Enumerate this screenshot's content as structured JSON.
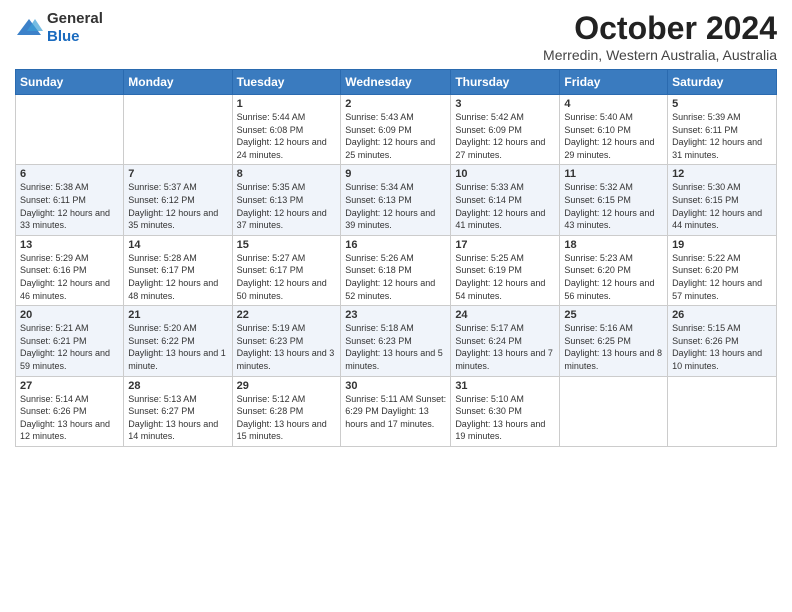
{
  "header": {
    "logo_line1": "General",
    "logo_line2": "Blue",
    "month": "October 2024",
    "location": "Merredin, Western Australia, Australia"
  },
  "days_of_week": [
    "Sunday",
    "Monday",
    "Tuesday",
    "Wednesday",
    "Thursday",
    "Friday",
    "Saturday"
  ],
  "weeks": [
    [
      {
        "day": "",
        "info": ""
      },
      {
        "day": "",
        "info": ""
      },
      {
        "day": "1",
        "info": "Sunrise: 5:44 AM\nSunset: 6:08 PM\nDaylight: 12 hours and 24 minutes."
      },
      {
        "day": "2",
        "info": "Sunrise: 5:43 AM\nSunset: 6:09 PM\nDaylight: 12 hours and 25 minutes."
      },
      {
        "day": "3",
        "info": "Sunrise: 5:42 AM\nSunset: 6:09 PM\nDaylight: 12 hours and 27 minutes."
      },
      {
        "day": "4",
        "info": "Sunrise: 5:40 AM\nSunset: 6:10 PM\nDaylight: 12 hours and 29 minutes."
      },
      {
        "day": "5",
        "info": "Sunrise: 5:39 AM\nSunset: 6:11 PM\nDaylight: 12 hours and 31 minutes."
      }
    ],
    [
      {
        "day": "6",
        "info": "Sunrise: 5:38 AM\nSunset: 6:11 PM\nDaylight: 12 hours and 33 minutes."
      },
      {
        "day": "7",
        "info": "Sunrise: 5:37 AM\nSunset: 6:12 PM\nDaylight: 12 hours and 35 minutes."
      },
      {
        "day": "8",
        "info": "Sunrise: 5:35 AM\nSunset: 6:13 PM\nDaylight: 12 hours and 37 minutes."
      },
      {
        "day": "9",
        "info": "Sunrise: 5:34 AM\nSunset: 6:13 PM\nDaylight: 12 hours and 39 minutes."
      },
      {
        "day": "10",
        "info": "Sunrise: 5:33 AM\nSunset: 6:14 PM\nDaylight: 12 hours and 41 minutes."
      },
      {
        "day": "11",
        "info": "Sunrise: 5:32 AM\nSunset: 6:15 PM\nDaylight: 12 hours and 43 minutes."
      },
      {
        "day": "12",
        "info": "Sunrise: 5:30 AM\nSunset: 6:15 PM\nDaylight: 12 hours and 44 minutes."
      }
    ],
    [
      {
        "day": "13",
        "info": "Sunrise: 5:29 AM\nSunset: 6:16 PM\nDaylight: 12 hours and 46 minutes."
      },
      {
        "day": "14",
        "info": "Sunrise: 5:28 AM\nSunset: 6:17 PM\nDaylight: 12 hours and 48 minutes."
      },
      {
        "day": "15",
        "info": "Sunrise: 5:27 AM\nSunset: 6:17 PM\nDaylight: 12 hours and 50 minutes."
      },
      {
        "day": "16",
        "info": "Sunrise: 5:26 AM\nSunset: 6:18 PM\nDaylight: 12 hours and 52 minutes."
      },
      {
        "day": "17",
        "info": "Sunrise: 5:25 AM\nSunset: 6:19 PM\nDaylight: 12 hours and 54 minutes."
      },
      {
        "day": "18",
        "info": "Sunrise: 5:23 AM\nSunset: 6:20 PM\nDaylight: 12 hours and 56 minutes."
      },
      {
        "day": "19",
        "info": "Sunrise: 5:22 AM\nSunset: 6:20 PM\nDaylight: 12 hours and 57 minutes."
      }
    ],
    [
      {
        "day": "20",
        "info": "Sunrise: 5:21 AM\nSunset: 6:21 PM\nDaylight: 12 hours and 59 minutes."
      },
      {
        "day": "21",
        "info": "Sunrise: 5:20 AM\nSunset: 6:22 PM\nDaylight: 13 hours and 1 minute."
      },
      {
        "day": "22",
        "info": "Sunrise: 5:19 AM\nSunset: 6:23 PM\nDaylight: 13 hours and 3 minutes."
      },
      {
        "day": "23",
        "info": "Sunrise: 5:18 AM\nSunset: 6:23 PM\nDaylight: 13 hours and 5 minutes."
      },
      {
        "day": "24",
        "info": "Sunrise: 5:17 AM\nSunset: 6:24 PM\nDaylight: 13 hours and 7 minutes."
      },
      {
        "day": "25",
        "info": "Sunrise: 5:16 AM\nSunset: 6:25 PM\nDaylight: 13 hours and 8 minutes."
      },
      {
        "day": "26",
        "info": "Sunrise: 5:15 AM\nSunset: 6:26 PM\nDaylight: 13 hours and 10 minutes."
      }
    ],
    [
      {
        "day": "27",
        "info": "Sunrise: 5:14 AM\nSunset: 6:26 PM\nDaylight: 13 hours and 12 minutes."
      },
      {
        "day": "28",
        "info": "Sunrise: 5:13 AM\nSunset: 6:27 PM\nDaylight: 13 hours and 14 minutes."
      },
      {
        "day": "29",
        "info": "Sunrise: 5:12 AM\nSunset: 6:28 PM\nDaylight: 13 hours and 15 minutes."
      },
      {
        "day": "30",
        "info": "Sunrise: 5:11 AM\nSunset: 6:29 PM\nDaylight: 13 hours and 17 minutes."
      },
      {
        "day": "31",
        "info": "Sunrise: 5:10 AM\nSunset: 6:30 PM\nDaylight: 13 hours and 19 minutes."
      },
      {
        "day": "",
        "info": ""
      },
      {
        "day": "",
        "info": ""
      }
    ]
  ]
}
